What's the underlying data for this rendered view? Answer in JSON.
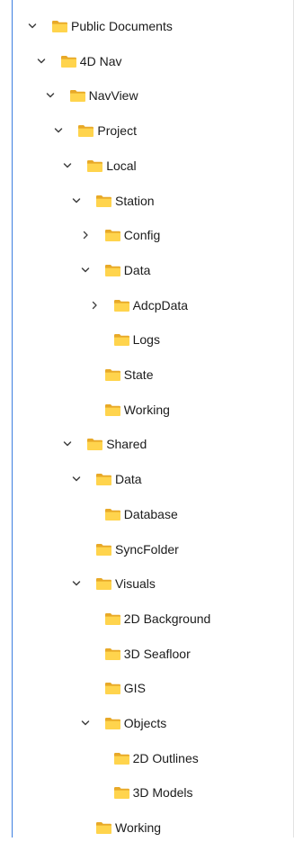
{
  "tree": {
    "colors": {
      "folder_front": "#FFD44D",
      "folder_back": "#E8A928",
      "chevron": "#404040",
      "text": "#1b1b1b",
      "focus_border": "#3d7fe0"
    },
    "items": [
      {
        "label": "Public Documents",
        "depth": 0,
        "state": "expanded"
      },
      {
        "label": "4D Nav",
        "depth": 1,
        "state": "expanded"
      },
      {
        "label": "NavView",
        "depth": 2,
        "state": "expanded"
      },
      {
        "label": "Project",
        "depth": 3,
        "state": "expanded"
      },
      {
        "label": "Local",
        "depth": 4,
        "state": "expanded"
      },
      {
        "label": "Station",
        "depth": 5,
        "state": "expanded"
      },
      {
        "label": "Config",
        "depth": 6,
        "state": "collapsed"
      },
      {
        "label": "Data",
        "depth": 6,
        "state": "expanded"
      },
      {
        "label": "AdcpData",
        "depth": 7,
        "state": "collapsed"
      },
      {
        "label": "Logs",
        "depth": 7,
        "state": "leaf"
      },
      {
        "label": "State",
        "depth": 6,
        "state": "leaf"
      },
      {
        "label": "Working",
        "depth": 6,
        "state": "leaf"
      },
      {
        "label": "Shared",
        "depth": 4,
        "state": "expanded"
      },
      {
        "label": "Data",
        "depth": 5,
        "state": "expanded"
      },
      {
        "label": "Database",
        "depth": 6,
        "state": "leaf"
      },
      {
        "label": "SyncFolder",
        "depth": 5,
        "state": "leaf"
      },
      {
        "label": "Visuals",
        "depth": 5,
        "state": "expanded"
      },
      {
        "label": "2D Background",
        "depth": 6,
        "state": "leaf"
      },
      {
        "label": "3D Seafloor",
        "depth": 6,
        "state": "leaf"
      },
      {
        "label": "GIS",
        "depth": 6,
        "state": "leaf"
      },
      {
        "label": "Objects",
        "depth": 6,
        "state": "expanded"
      },
      {
        "label": "2D Outlines",
        "depth": 7,
        "state": "leaf"
      },
      {
        "label": "3D Models",
        "depth": 7,
        "state": "leaf"
      },
      {
        "label": "Working",
        "depth": 5,
        "state": "leaf"
      }
    ]
  }
}
